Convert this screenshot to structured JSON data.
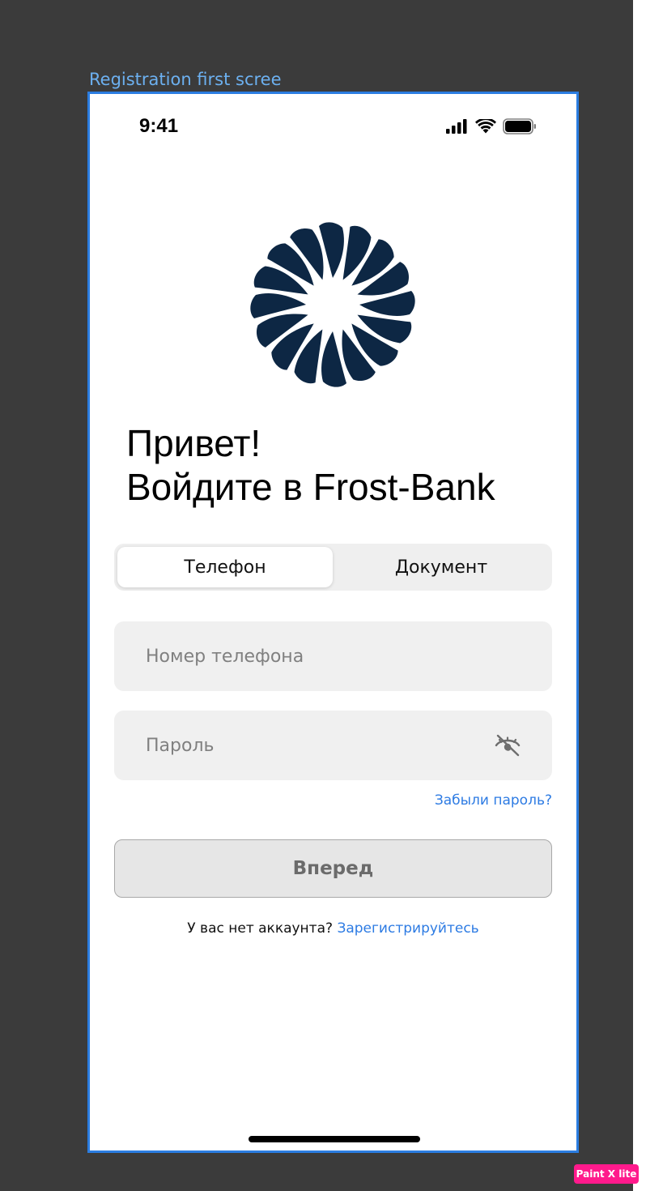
{
  "canvas": {
    "frame_label": "Registration first scree",
    "watermark": "Paint X lite"
  },
  "status_bar": {
    "time": "9:41",
    "icons": [
      "cellular-signal-icon",
      "wifi-icon",
      "battery-icon"
    ]
  },
  "logo": {
    "icon": "frost-bank-logo-icon",
    "color": "#0d2744"
  },
  "greeting": {
    "line1": "Привет!",
    "line2": "Войдите в Frost-Bank"
  },
  "login_tabs": {
    "items": [
      {
        "label": "Телефон",
        "selected": true
      },
      {
        "label": "Документ",
        "selected": false
      }
    ]
  },
  "form": {
    "phone": {
      "value": "",
      "placeholder": "Номер телефона"
    },
    "password": {
      "value": "",
      "placeholder": "Пароль",
      "toggle_icon": "eye-slash-icon"
    },
    "forgot_password": "Забыли пароль?",
    "submit_label": "Вперед"
  },
  "signup": {
    "prompt": "У вас нет аккаунта?",
    "link": "Зарегистрируйтесь"
  },
  "colors": {
    "accent_link": "#2d7be3",
    "frame_border": "#2b7de1",
    "field_bg": "#f0f0f0",
    "button_bg": "#e6e6e6",
    "canvas_bg": "#3b3b3b"
  }
}
